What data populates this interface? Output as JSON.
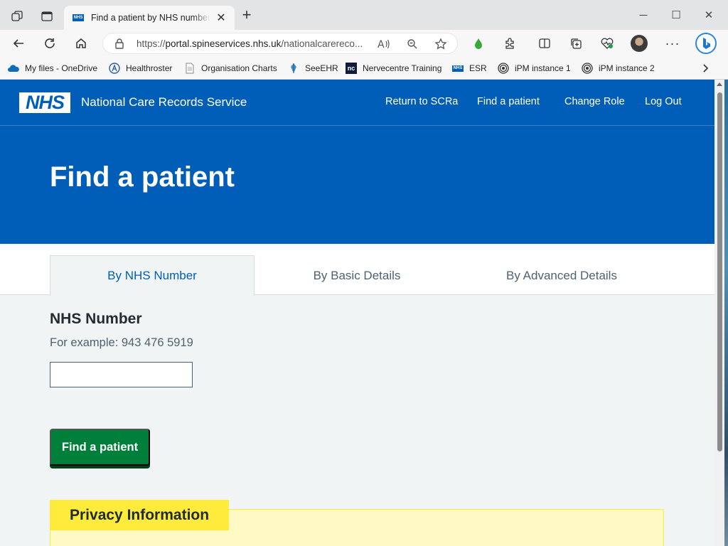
{
  "browser": {
    "tab": {
      "favicon_text": "NHS",
      "title": "Find a patient by NHS number - NHS"
    },
    "address": {
      "url_scheme": "https://",
      "url_host": "portal.spineservices.nhs.uk",
      "url_path": "/nationalcarereco..."
    },
    "bookmarks": [
      {
        "label": "My files - OneDrive",
        "icon": "onedrive-icon"
      },
      {
        "label": "Healthroster",
        "icon": "healthroster-icon"
      },
      {
        "label": "Organisation Charts",
        "icon": "document-icon"
      },
      {
        "label": "SeeEHR",
        "icon": "seeehr-icon"
      },
      {
        "label": "Nervecentre Training",
        "icon": "nervecentre-icon",
        "icon_text": "nc"
      },
      {
        "label": "ESR",
        "icon": "nhs-icon",
        "icon_text": "NHS"
      },
      {
        "label": "iPM instance 1",
        "icon": "ipm-icon"
      },
      {
        "label": "iPM instance 2",
        "icon": "ipm-icon"
      }
    ]
  },
  "header": {
    "logo_text": "NHS",
    "service_name": "National Care Records Service",
    "nav": [
      "Return to SCRa",
      "Find a patient",
      "Change Role",
      "Log Out"
    ]
  },
  "hero": {
    "title": "Find a patient"
  },
  "tabs": [
    {
      "label": "By NHS Number",
      "active": true
    },
    {
      "label": "By Basic Details",
      "active": false
    },
    {
      "label": "By Advanced Details",
      "active": false
    }
  ],
  "form": {
    "label": "NHS Number",
    "hint": "For example: 943 476 5919",
    "value": "",
    "submit_label": "Find a patient"
  },
  "privacy": {
    "heading": "Privacy Information"
  },
  "colors": {
    "nhs_blue": "#005eb8",
    "button_green": "#007f3b",
    "warning_yellow": "#ffeb3b",
    "page_background": "#f0f4f5"
  }
}
